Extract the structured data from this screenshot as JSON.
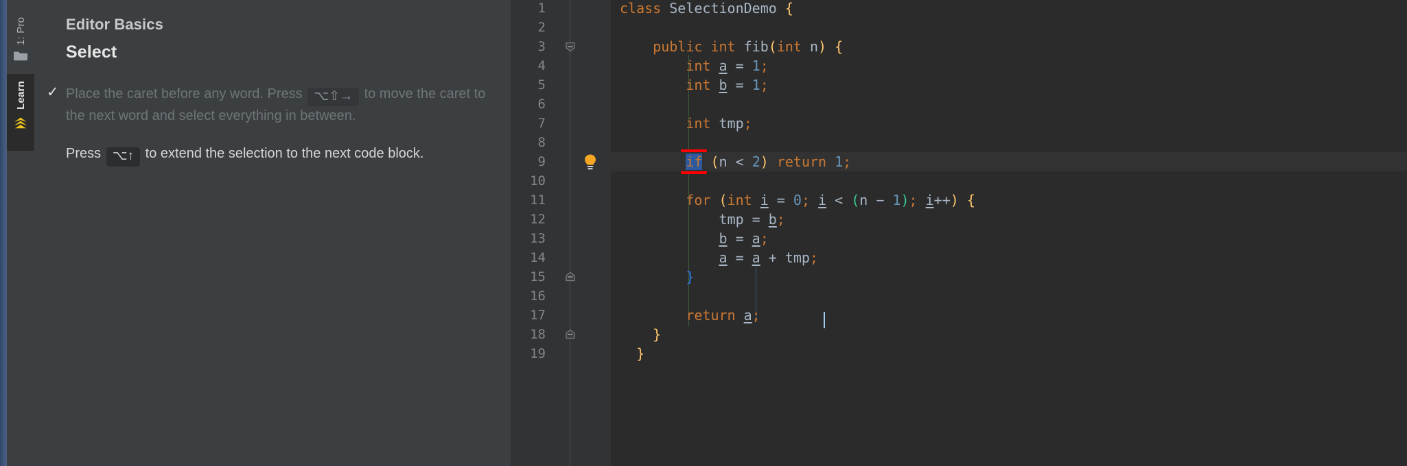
{
  "toolwindows": {
    "project_tab": "1: Pro",
    "project_icon": "folder-icon",
    "learn_tab": "Learn",
    "learn_icon": "learn-rank-chevron-icon"
  },
  "learn_panel": {
    "eyebrow": "Editor Basics",
    "title": "Select",
    "tasks": [
      {
        "done": true,
        "check_glyph": "✓",
        "parts": [
          {
            "type": "text",
            "value": "Place the caret before any word. Press "
          },
          {
            "type": "kbd",
            "value": "⌥⇧→"
          },
          {
            "type": "text",
            "value": " to move the caret to the next word and select everything in between."
          }
        ]
      },
      {
        "done": false,
        "check_glyph": "",
        "parts": [
          {
            "type": "text",
            "value": "Press "
          },
          {
            "type": "kbd",
            "value": "⌥↑"
          },
          {
            "type": "text",
            "value": " to extend the selection to the next code block."
          }
        ]
      }
    ]
  },
  "editor": {
    "bulb_line": 9,
    "bulb_icon": "intention-lightbulb-icon",
    "highlighted_line": 9,
    "selection_token": "if",
    "annotation_color": "#ff0000",
    "selection_color": "#2d5a9e",
    "fold_marks": [
      {
        "line": 3,
        "type": "collapse-down"
      },
      {
        "line": 15,
        "type": "collapse-up"
      },
      {
        "line": 18,
        "type": "collapse-up"
      }
    ],
    "line_numbers": [
      1,
      2,
      3,
      4,
      5,
      6,
      7,
      8,
      9,
      10,
      11,
      12,
      13,
      14,
      15,
      16,
      17,
      18,
      19
    ],
    "lines": [
      {
        "n": 1,
        "tokens": [
          {
            "t": "kw",
            "v": "class"
          },
          {
            "t": "plain",
            "v": " "
          },
          {
            "t": "cls",
            "v": "SelectionDemo"
          },
          {
            "t": "plain",
            "v": " "
          },
          {
            "t": "br-y",
            "v": "{"
          }
        ]
      },
      {
        "n": 2,
        "tokens": []
      },
      {
        "n": 3,
        "tokens": [
          {
            "t": "plain",
            "v": "    "
          },
          {
            "t": "kw",
            "v": "public"
          },
          {
            "t": "plain",
            "v": " "
          },
          {
            "t": "kw",
            "v": "int"
          },
          {
            "t": "plain",
            "v": " "
          },
          {
            "t": "id",
            "v": "fib"
          },
          {
            "t": "br-y",
            "v": "("
          },
          {
            "t": "kw",
            "v": "int"
          },
          {
            "t": "plain",
            "v": " "
          },
          {
            "t": "id",
            "v": "n"
          },
          {
            "t": "br-y",
            "v": ")"
          },
          {
            "t": "plain",
            "v": " "
          },
          {
            "t": "br-y",
            "v": "{"
          }
        ]
      },
      {
        "n": 4,
        "tokens": [
          {
            "t": "plain",
            "v": "        "
          },
          {
            "t": "kw",
            "v": "int"
          },
          {
            "t": "plain",
            "v": " "
          },
          {
            "t": "var-u",
            "v": "a"
          },
          {
            "t": "plain",
            "v": " = "
          },
          {
            "t": "num",
            "v": "1"
          },
          {
            "t": "punc",
            "v": ";"
          }
        ]
      },
      {
        "n": 5,
        "tokens": [
          {
            "t": "plain",
            "v": "        "
          },
          {
            "t": "kw",
            "v": "int"
          },
          {
            "t": "plain",
            "v": " "
          },
          {
            "t": "var-u",
            "v": "b"
          },
          {
            "t": "plain",
            "v": " = "
          },
          {
            "t": "num",
            "v": "1"
          },
          {
            "t": "punc",
            "v": ";"
          }
        ]
      },
      {
        "n": 6,
        "tokens": []
      },
      {
        "n": 7,
        "tokens": [
          {
            "t": "plain",
            "v": "        "
          },
          {
            "t": "kw",
            "v": "int"
          },
          {
            "t": "plain",
            "v": " "
          },
          {
            "t": "id",
            "v": "tmp"
          },
          {
            "t": "punc",
            "v": ";"
          }
        ]
      },
      {
        "n": 8,
        "tokens": []
      },
      {
        "n": 9,
        "tokens": [
          {
            "t": "plain",
            "v": "        "
          },
          {
            "t": "sel",
            "v": "if"
          },
          {
            "t": "plain",
            "v": " "
          },
          {
            "t": "br-y",
            "v": "("
          },
          {
            "t": "id",
            "v": "n"
          },
          {
            "t": "plain",
            "v": " < "
          },
          {
            "t": "num",
            "v": "2"
          },
          {
            "t": "br-y",
            "v": ")"
          },
          {
            "t": "plain",
            "v": " "
          },
          {
            "t": "kw",
            "v": "return"
          },
          {
            "t": "plain",
            "v": " "
          },
          {
            "t": "num",
            "v": "1"
          },
          {
            "t": "punc",
            "v": ";"
          }
        ]
      },
      {
        "n": 10,
        "tokens": []
      },
      {
        "n": 11,
        "tokens": [
          {
            "t": "plain",
            "v": "        "
          },
          {
            "t": "kw",
            "v": "for"
          },
          {
            "t": "plain",
            "v": " "
          },
          {
            "t": "br-y",
            "v": "("
          },
          {
            "t": "kw",
            "v": "int"
          },
          {
            "t": "plain",
            "v": " "
          },
          {
            "t": "var-u",
            "v": "i"
          },
          {
            "t": "plain",
            "v": " = "
          },
          {
            "t": "num",
            "v": "0"
          },
          {
            "t": "punc",
            "v": ";"
          },
          {
            "t": "plain",
            "v": " "
          },
          {
            "t": "var-u",
            "v": "i"
          },
          {
            "t": "plain",
            "v": " < "
          },
          {
            "t": "br-g",
            "v": "("
          },
          {
            "t": "id",
            "v": "n"
          },
          {
            "t": "plain",
            "v": " "
          },
          {
            "t": "plain",
            "v": "−"
          },
          {
            "t": "plain",
            "v": " "
          },
          {
            "t": "num",
            "v": "1"
          },
          {
            "t": "br-g",
            "v": ")"
          },
          {
            "t": "punc",
            "v": ";"
          },
          {
            "t": "plain",
            "v": " "
          },
          {
            "t": "var-u",
            "v": "i"
          },
          {
            "t": "plain",
            "v": "++"
          },
          {
            "t": "br-y",
            "v": ")"
          },
          {
            "t": "plain",
            "v": " "
          },
          {
            "t": "br-y",
            "v": "{"
          }
        ]
      },
      {
        "n": 12,
        "tokens": [
          {
            "t": "plain",
            "v": "            "
          },
          {
            "t": "id",
            "v": "tmp"
          },
          {
            "t": "plain",
            "v": " = "
          },
          {
            "t": "var-u",
            "v": "b"
          },
          {
            "t": "punc",
            "v": ";"
          }
        ]
      },
      {
        "n": 13,
        "tokens": [
          {
            "t": "plain",
            "v": "            "
          },
          {
            "t": "var-u",
            "v": "b"
          },
          {
            "t": "plain",
            "v": " = "
          },
          {
            "t": "var-u",
            "v": "a"
          },
          {
            "t": "punc",
            "v": ";"
          }
        ]
      },
      {
        "n": 14,
        "tokens": [
          {
            "t": "plain",
            "v": "            "
          },
          {
            "t": "var-u",
            "v": "a"
          },
          {
            "t": "plain",
            "v": " = "
          },
          {
            "t": "var-u",
            "v": "a"
          },
          {
            "t": "plain",
            "v": " + "
          },
          {
            "t": "id",
            "v": "tmp"
          },
          {
            "t": "punc",
            "v": ";"
          }
        ]
      },
      {
        "n": 15,
        "tokens": [
          {
            "t": "plain",
            "v": "        "
          },
          {
            "t": "br-b",
            "v": "}"
          }
        ]
      },
      {
        "n": 16,
        "tokens": []
      },
      {
        "n": 17,
        "tokens": [
          {
            "t": "plain",
            "v": "        "
          },
          {
            "t": "kw",
            "v": "return"
          },
          {
            "t": "plain",
            "v": " "
          },
          {
            "t": "var-u",
            "v": "a"
          },
          {
            "t": "punc",
            "v": ";"
          }
        ]
      },
      {
        "n": 18,
        "tokens": [
          {
            "t": "plain",
            "v": "    "
          },
          {
            "t": "br-y",
            "v": "}"
          }
        ]
      },
      {
        "n": 19,
        "tokens": [
          {
            "t": "plain",
            "v": "  "
          },
          {
            "t": "br-y",
            "v": "}"
          }
        ]
      }
    ]
  }
}
